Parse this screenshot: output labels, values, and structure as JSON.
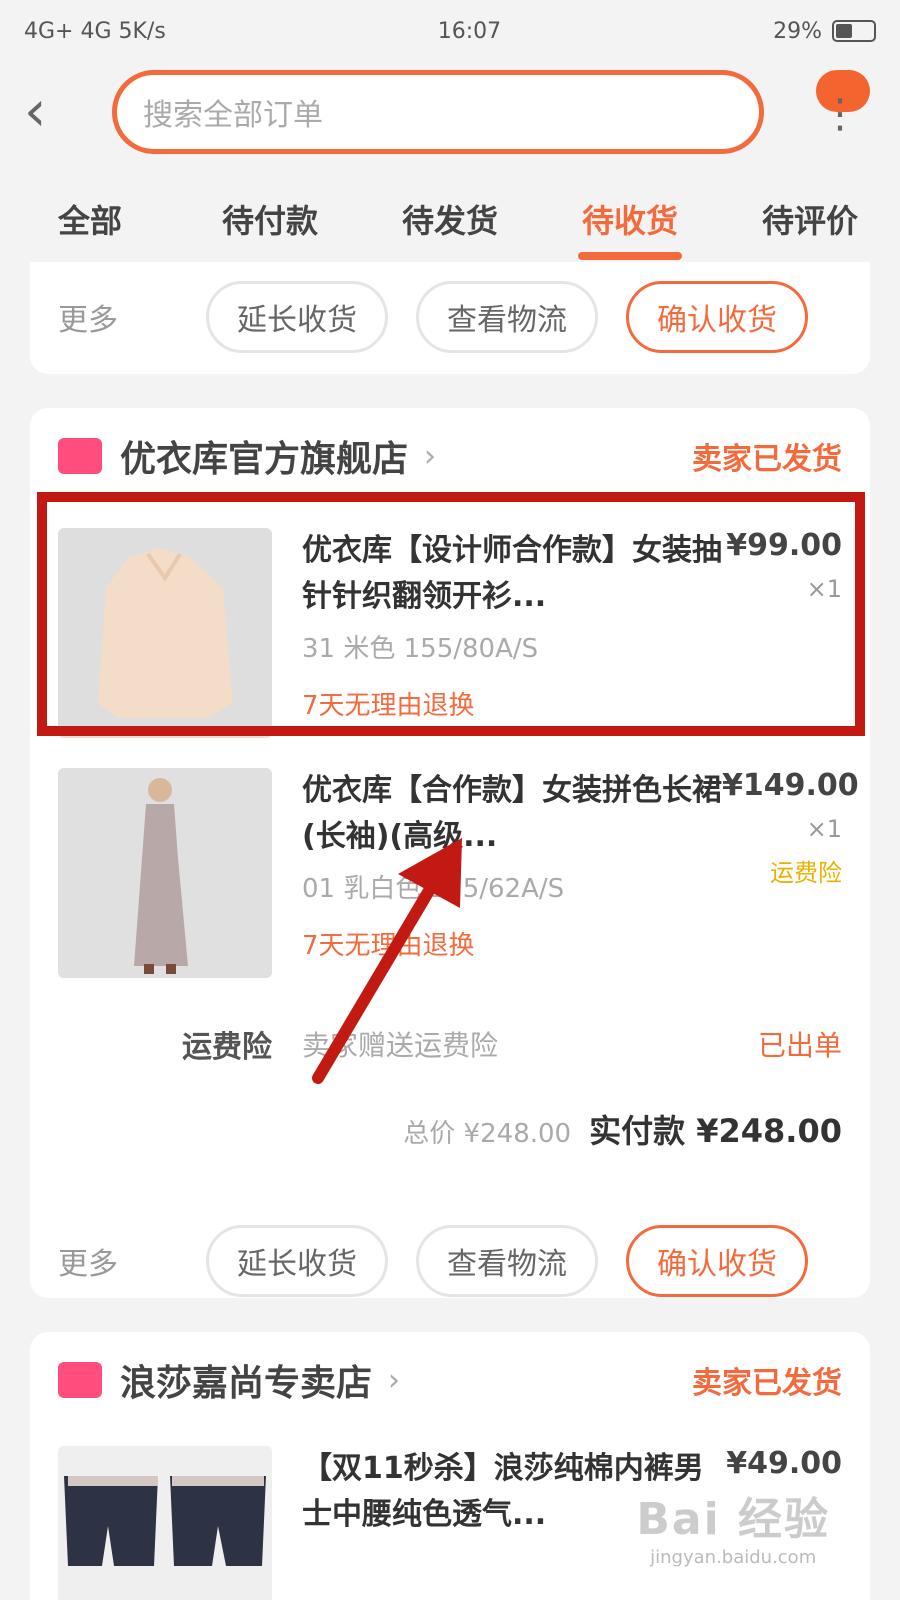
{
  "status": {
    "left": "4G+ 4G 5K/s",
    "time": "16:07",
    "right": "29%"
  },
  "nav": {
    "back_glyph": "‹",
    "search_placeholder": "搜索全部订单",
    "more_glyph": "⋮"
  },
  "tabs": [
    {
      "label": "全部"
    },
    {
      "label": "待付款"
    },
    {
      "label": "待发货"
    },
    {
      "label": "待收货"
    },
    {
      "label": "待评价"
    }
  ],
  "actions": {
    "more": "更多",
    "extend": "延长收货",
    "logistics": "查看物流",
    "confirm": "确认收货"
  },
  "orders": [
    {
      "shop": "优衣库官方旗舰店",
      "status": "卖家已发货",
      "items": [
        {
          "title": "优衣库【设计师合作款】女装抽针针织翻领开衫...",
          "sku": "31 米色 155/80A/S",
          "tag": "7天无理由退换",
          "price": "¥99.00",
          "qty": "×1"
        },
        {
          "title": "优衣库【合作款】女装拼色长裙(长袖)(高级...",
          "sku": "01 乳白色 155/62A/S",
          "tag": "7天无理由退换",
          "price": "¥149.00",
          "qty": "×1",
          "ship_label": "运费险"
        }
      ],
      "shipping": {
        "title": "运费险",
        "desc": "卖家赠送运费险",
        "state": "已出单"
      },
      "total": {
        "total": "总价 ¥248.00",
        "pay": "实付款 ¥248.00"
      }
    },
    {
      "shop": "浪莎嘉尚专卖店",
      "status": "卖家已发货",
      "items": [
        {
          "title": "【双11秒杀】浪莎纯棉内裤男士中腰纯色透气...",
          "price": "¥49.00"
        }
      ]
    }
  ],
  "watermark": {
    "logo": "Bai 经验",
    "url": "jingyan.baidu.com"
  },
  "colors": {
    "accent": "#f36b3c",
    "highlight": "#c21a12",
    "shop_logo": "#ff4d7e"
  }
}
